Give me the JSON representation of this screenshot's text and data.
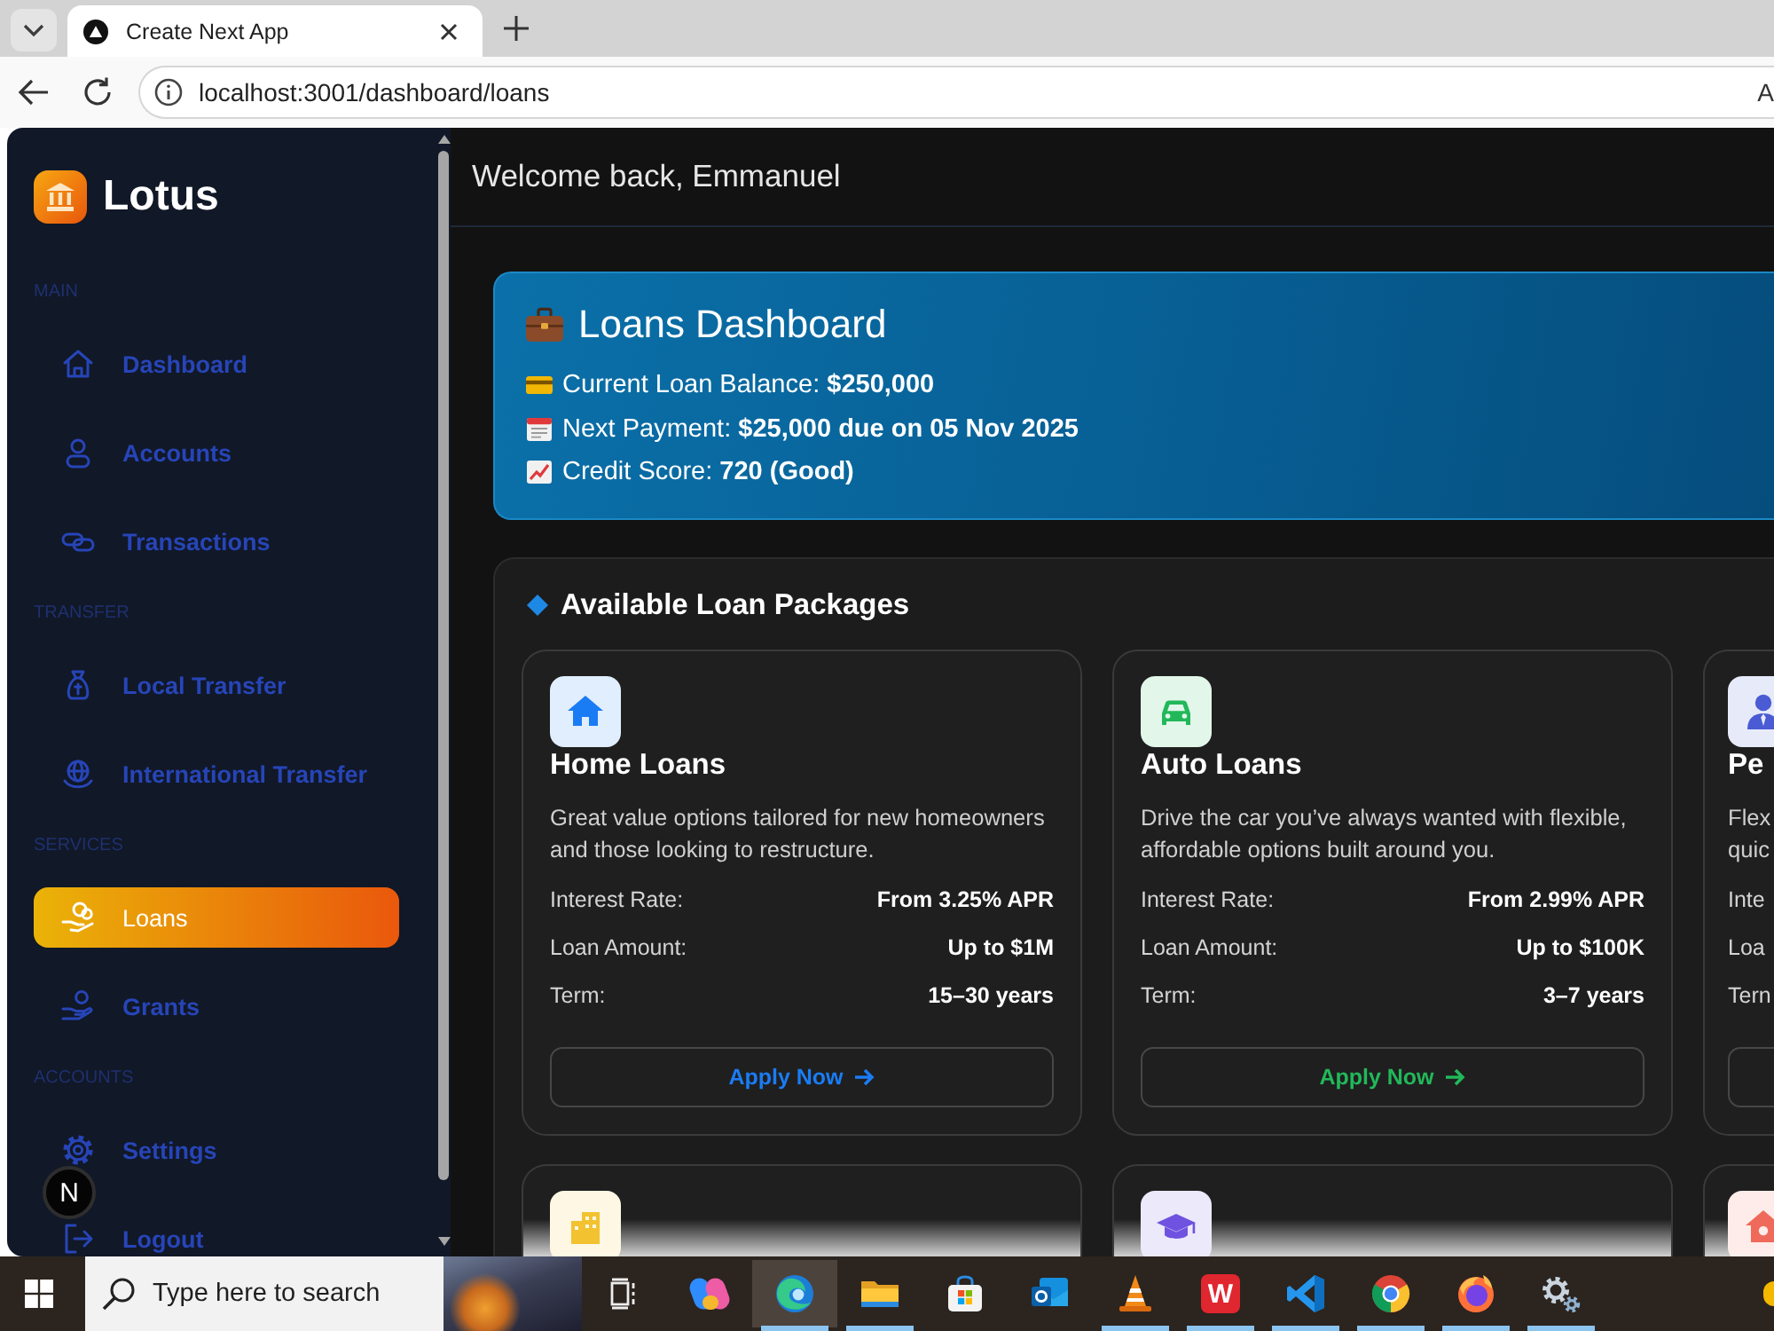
{
  "browser": {
    "tabs": [
      {
        "title": "Create Next App",
        "selected": true
      }
    ],
    "url": "localhost:3001/dashboard/loans",
    "read_aloud": "A"
  },
  "sidebar": {
    "brand": "Lotus",
    "sections": [
      {
        "label": "MAIN",
        "items": [
          {
            "label": "Dashboard",
            "kind": "home",
            "selected": false
          },
          {
            "label": "Accounts",
            "kind": "user",
            "selected": false
          },
          {
            "label": "Transactions",
            "kind": "exchange",
            "selected": false
          }
        ]
      },
      {
        "label": "TRANSFER",
        "items": [
          {
            "label": "Local Transfer",
            "kind": "moneybag",
            "selected": false
          },
          {
            "label": "International Transfer",
            "kind": "globe",
            "selected": false
          }
        ]
      },
      {
        "label": "SERVICES",
        "items": [
          {
            "label": "Loans",
            "kind": "coins",
            "selected": true
          },
          {
            "label": "Grants",
            "kind": "grant",
            "selected": false
          }
        ]
      },
      {
        "label": "ACCOUNTS",
        "items": [
          {
            "label": "Settings",
            "kind": "gear",
            "selected": false
          },
          {
            "label": "Logout",
            "kind": "logout",
            "selected": false
          }
        ]
      }
    ],
    "dev_badge": "N"
  },
  "header": {
    "greeting": "Welcome back, Emmanuel"
  },
  "summary": {
    "title": "Loans Dashboard",
    "lines": [
      {
        "kind": "card",
        "text": "Current Loan Balance: **$250,000**"
      },
      {
        "kind": "calendar",
        "text": "Next Payment: **$25,000 due on 05 Nov 2025**"
      },
      {
        "kind": "chart",
        "text": "Credit Score: **720 (Good)**"
      }
    ]
  },
  "packages": {
    "title": "Available Loan Packages",
    "cards": [
      {
        "kind": "house",
        "color": "#1a7cf5",
        "faded": false,
        "title": "Home Loans",
        "description": "Great value options tailored for new homeowners and those looking to restructure.",
        "terms": [
          {
            "label": "Interest Rate:",
            "value": "From 3.25% APR"
          },
          {
            "label": "Loan Amount:",
            "value": "Up to $1M"
          },
          {
            "label": "Term:",
            "value": "15–30 years"
          }
        ],
        "button": {
          "kind": "outline",
          "label": "Apply Now"
        }
      },
      {
        "kind": "car",
        "color": "#22b85a",
        "faded": false,
        "title": "Auto Loans",
        "description": "Drive the car you’ve always wanted with flexible, affordable options built around you.",
        "terms": [
          {
            "label": "Interest Rate:",
            "value": "From 2.99% APR"
          },
          {
            "label": "Loan Amount:",
            "value": "Up to $100K"
          },
          {
            "label": "Term:",
            "value": "3–7 years"
          }
        ],
        "button": {
          "kind": "outline",
          "label": "Apply Now"
        }
      },
      {
        "kind": "person",
        "color": "#4a5bd4",
        "faded": false,
        "title": "Pe",
        "description": "Flex quic",
        "terms": [
          {
            "label": "Inte"
          },
          {
            "label": "Loa"
          },
          {
            "label": "Tern"
          }
        ],
        "button": {
          "kind": "outline"
        }
      },
      {
        "kind": "building",
        "color": "#f2c230",
        "faded": true
      },
      {
        "kind": "cap",
        "color": "#6f52e0",
        "faded": true
      },
      {
        "kind": "home-care",
        "color": "#ef6a5a",
        "faded": true
      }
    ]
  },
  "taskbar": {
    "search_placeholder": "Type here to search",
    "apps": [
      {
        "kind": "swirl",
        "running": false,
        "active": false
      },
      {
        "kind": "wave",
        "running": true,
        "active": true
      },
      {
        "kind": "folder",
        "running": true,
        "active": false
      },
      {
        "kind": "bag",
        "running": false,
        "active": false
      },
      {
        "kind": "mail",
        "running": false,
        "active": false
      },
      {
        "kind": "cone",
        "running": true,
        "active": false
      },
      {
        "kind": "letter",
        "glyph": "W",
        "running": true,
        "active": false
      },
      {
        "kind": "ribbon",
        "running": true,
        "active": false
      },
      {
        "kind": "ring",
        "running": true,
        "active": false
      },
      {
        "kind": "fox",
        "running": true,
        "active": false
      },
      {
        "kind": "gears",
        "running": true,
        "active": false
      }
    ],
    "tray": [
      {
        "kind": "sun"
      }
    ]
  }
}
